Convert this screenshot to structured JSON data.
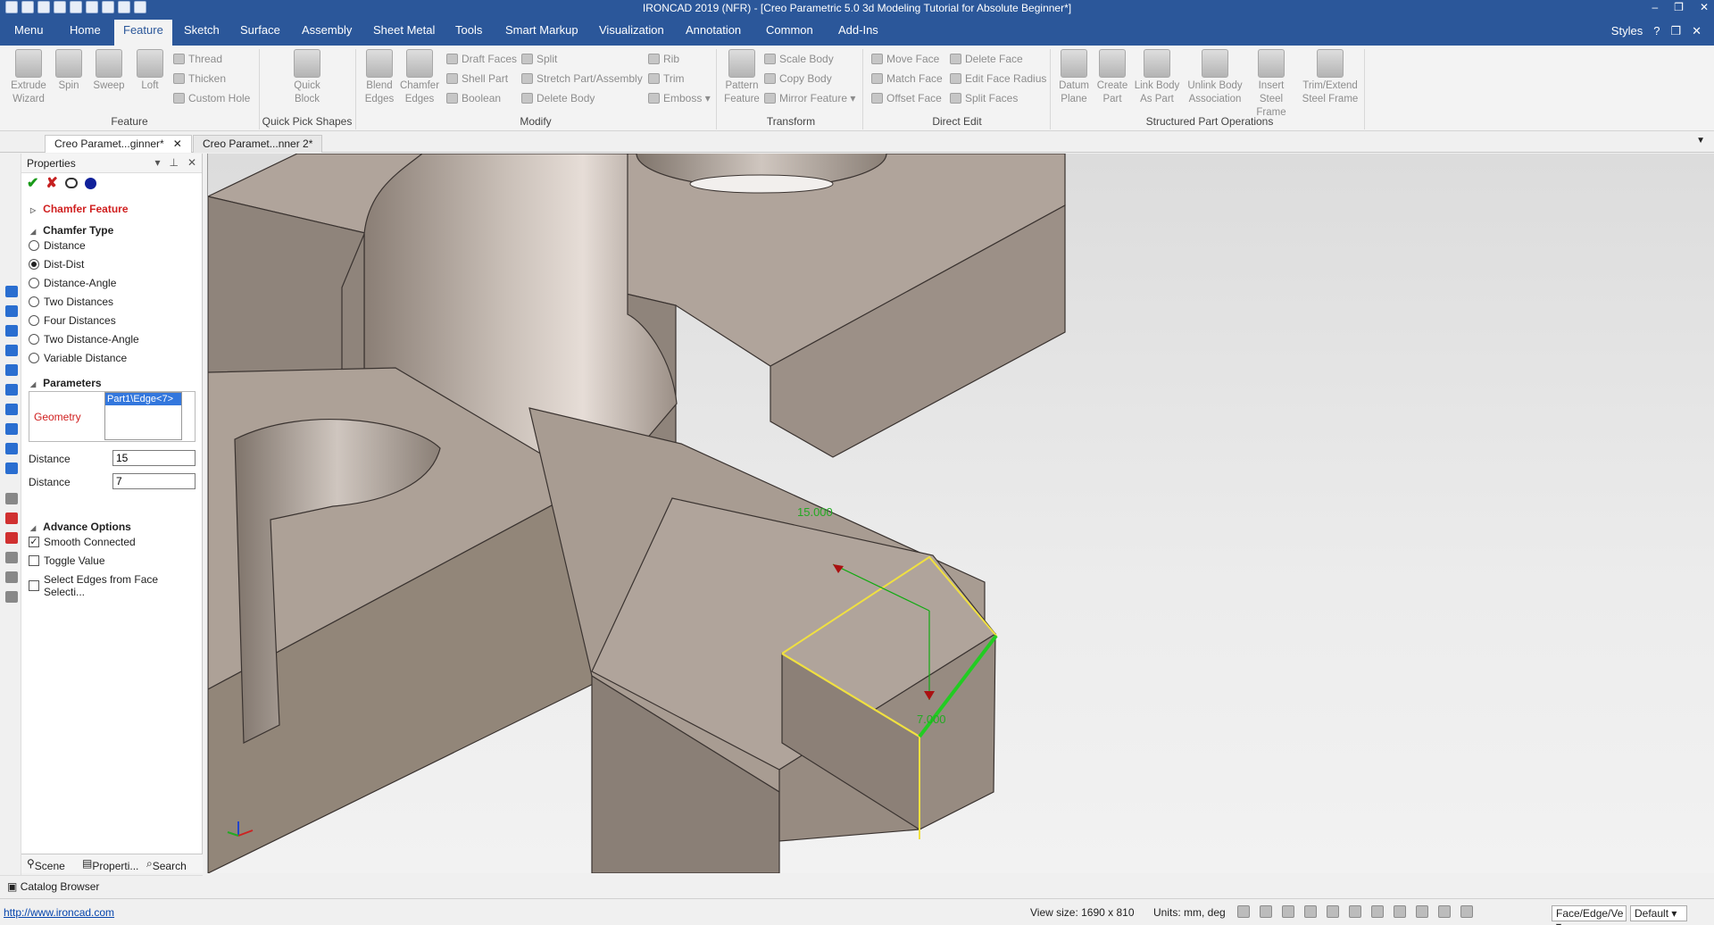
{
  "window": {
    "title": "IRONCAD 2019 (NFR) - [Creo Parametric 5.0 3d Modeling Tutorial for Absolute Beginner*]"
  },
  "ribbon_tabs": [
    "Menu",
    "Home",
    "Feature",
    "Sketch",
    "Surface",
    "Assembly",
    "Sheet Metal",
    "Tools",
    "Smart Markup",
    "Visualization",
    "Annotation",
    "Common",
    "Add-Ins"
  ],
  "active_tab": "Feature",
  "styles_label": "Styles",
  "ribbon": {
    "feature": {
      "extrude": "Extrude Wizard",
      "spin": "Spin",
      "sweep": "Sweep",
      "loft": "Loft",
      "thread": "Thread",
      "thicken": "Thicken",
      "custom_hole": "Custom Hole",
      "group": "Feature"
    },
    "quick_pick": {
      "quick_block": "Quick Block",
      "group": "Quick Pick Shapes"
    },
    "modify": {
      "blend_edges": "Blend Edges",
      "chamfer_edges": "Chamfer Edges",
      "draft_faces": "Draft Faces",
      "shell_part": "Shell Part",
      "boolean": "Boolean",
      "split": "Split",
      "stretch": "Stretch Part/Assembly",
      "delete_body": "Delete Body",
      "rib": "Rib",
      "trim": "Trim",
      "emboss": "Emboss",
      "group": "Modify"
    },
    "transform": {
      "pattern": "Pattern Feature",
      "scale_body": "Scale Body",
      "copy_body": "Copy Body",
      "mirror_feature": "Mirror Feature",
      "group": "Transform"
    },
    "direct_edit": {
      "move_face": "Move Face",
      "match_face": "Match Face",
      "offset_face": "Offset Face",
      "delete_face": "Delete Face",
      "edit_face_radius": "Edit Face Radius",
      "split_faces": "Split Faces",
      "group": "Direct Edit"
    },
    "structured": {
      "datum_plane": "Datum Plane",
      "create_part": "Create Part",
      "link_body": "Link Body As Part",
      "unlink_body": "Unlink Body Association",
      "insert_steel": "Insert Steel Frame",
      "trim_extend": "Trim/Extend Steel Frame",
      "group": "Structured Part Operations"
    }
  },
  "doc_tabs": [
    "Creo Paramet...ginner*",
    "Creo Paramet...nner 2*"
  ],
  "properties": {
    "header": "Properties",
    "feature_title": "Chamfer Feature",
    "chamfer_type_label": "Chamfer Type",
    "chamfer_types": [
      "Distance",
      "Dist-Dist",
      "Distance-Angle",
      "Two Distances",
      "Four Distances",
      "Two Distance-Angle",
      "Variable Distance"
    ],
    "selected_type": "Dist-Dist",
    "parameters_label": "Parameters",
    "geometry_label": "Geometry",
    "geometry_value": "Part1\\Edge<7>",
    "distance1_label": "Distance",
    "distance1_value": "15",
    "distance2_label": "Distance",
    "distance2_value": "7",
    "advance_label": "Advance Options",
    "options": [
      {
        "label": "Smooth Connected",
        "checked": true
      },
      {
        "label": "Toggle Value",
        "checked": false
      },
      {
        "label": "Select Edges from Face Selecti...",
        "checked": false
      }
    ],
    "footer_tabs": [
      "Scene",
      "Properti...",
      "Search"
    ]
  },
  "catalog_browser": "Catalog Browser",
  "viewport": {
    "dim1": "15.000",
    "dim2": "7.000",
    "colors": {
      "body": "#a69a91",
      "highlight_edge": "#22cc22",
      "preview": "#f0e040"
    }
  },
  "status": {
    "link": "http://www.ironcad.com",
    "view_size": "View size: 1690 x  810",
    "units": "Units: mm, deg",
    "filter": "Face/Edge/Ve",
    "scheme": "Default"
  }
}
